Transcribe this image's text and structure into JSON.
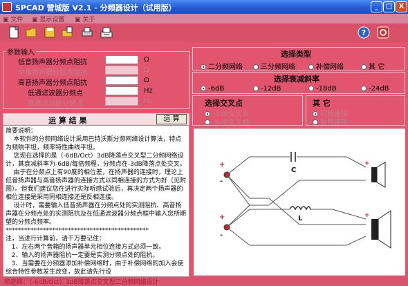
{
  "window": {
    "title": "SPCAD 营城版 V2.1 - 分频器设计（试用版）",
    "buttons": {
      "minimize": "_",
      "maximize": "□",
      "close": "X"
    }
  },
  "menu": {
    "items": [
      "文件",
      "显示设置",
      "关于"
    ]
  },
  "toolbar": {
    "icons": [
      "new-icon",
      "open-folder-icon",
      "save-icon",
      "open-file-icon",
      "print-icon",
      "printer-icon",
      "help-icon",
      "exit-icon"
    ]
  },
  "params": {
    "title": "参数输入",
    "rows": [
      {
        "label": "低音扬声器分频点阻抗",
        "unit": "Ω",
        "enabled": true
      },
      {
        "label": "中音扬声器分频点阻抗",
        "unit": "Ω",
        "enabled": false
      },
      {
        "label": "高音扬声器分频点阻抗",
        "unit": "Ω",
        "enabled": true
      },
      {
        "label": "低通滤波器分频点",
        "unit": "Hz",
        "enabled": true
      },
      {
        "label": "高通滤波器分频点",
        "unit": "Hz",
        "enabled": false
      }
    ]
  },
  "results": {
    "title": "运 算 结 果",
    "button": "运 算",
    "text": "简要说明：\n    本软件的分频网络设计采用巴特沃斯分频网络设计算法，特点为频响平坦，频率特性曲线平坦。\n    您现在选择的是（-6dB/Oct）3dB降落点交叉型二分频网络设计，其衰减斜率为-6dB/每倍频程，分频点在-3dB降落点处交叉。\n    由于在分频点上有90度的相位差，在扬声器的连接时，理论上低音扬声器与高音扬声器的连接方式以同相连接的方式为好（见附图）。但我们建议您在进行实际听感试验后，再决定两个扬声器的相位连接是采用同相连接还是反相连接。\n    设计时，需要输入低音扬声器在分频点处的实测阻抗、高音扬声器在分频点处的实测阻抗及在低通滤波器分频点框中输入您所期望的分频点频率。\n**********************************************\n注，当进行计算前，请千万要记住：\n   1、左右两个音箱的扬声器单元相位连接方式必须一致。\n   2、输入的扬声器阻抗一定要是实测分频点处的阻抗。\n   3、当需要在分频器添加补偿网络时，由于补偿网络的加入会使综合特性参数发生改变，故此请先行设"
  },
  "type_select": {
    "title": "选择类型",
    "options": [
      "二分频网络",
      "三分频网络",
      "补偿网络",
      "其 它"
    ],
    "selected": 0
  },
  "slope": {
    "title": "选择衰减斜率",
    "options": [
      "-6dB",
      "-12dB",
      "-18dB",
      "-24dB"
    ],
    "selected": 0
  },
  "crossover": {
    "title": "选择交叉点",
    "options": [
      "-3dB交叉点",
      "-6dB交叉点"
    ],
    "selected": 0
  },
  "other": {
    "title": "其 它",
    "options": [
      "同相连接",
      "反相连接"
    ],
    "selected": 0
  },
  "diagram": {
    "capacitor_label": "C",
    "inductor_label": "L",
    "plus": "+",
    "minus": "-"
  },
  "status": {
    "text": "所选择：（-6dB/Oct）3dB降落点交叉型二分频网络设计"
  },
  "colors": {
    "background": "#e3546e",
    "titlebar": "#1f58d8",
    "panel_border": "#f4c0cc"
  }
}
